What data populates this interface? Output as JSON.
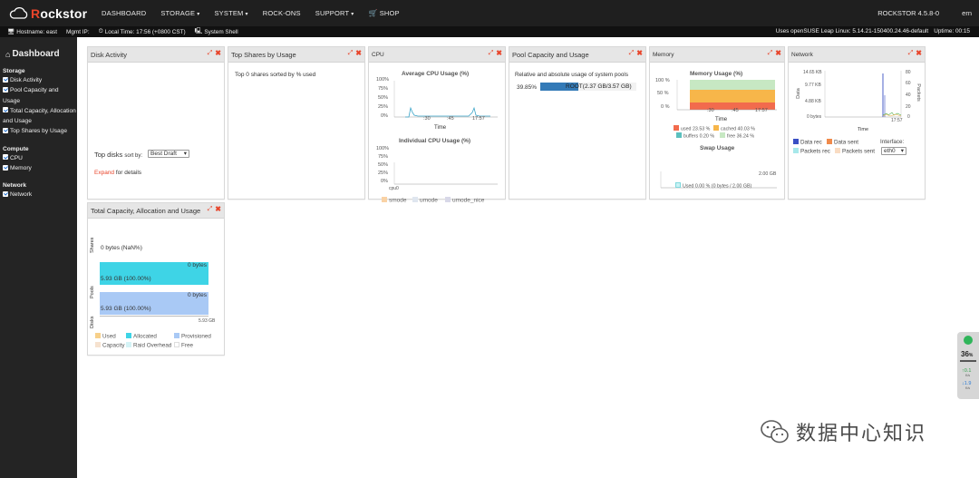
{
  "app": {
    "logo_text_prefix": "R",
    "logo_text_rest": "ockstor",
    "version": "ROCKSTOR 4.5.8-0",
    "user": "ern"
  },
  "nav": {
    "items": [
      {
        "label": "DASHBOARD",
        "caret": ""
      },
      {
        "label": "STORAGE",
        "caret": "▾"
      },
      {
        "label": "SYSTEM",
        "caret": "▾"
      },
      {
        "label": "ROCK-ONS",
        "caret": ""
      },
      {
        "label": "SUPPORT",
        "caret": "▾"
      }
    ],
    "shop_label": "SHOP"
  },
  "status": {
    "hostname": "Hostname: east",
    "mgmt_ip": "Mgmt IP:",
    "local_time": "Local Time: 17:56 (+0800 CST)",
    "system_shell": "System Shell",
    "os_info": "Uses openSUSE Leap  Linux: 5.14.21-150400.24.46-default",
    "uptime": "Uptime: 00:15"
  },
  "sidebar": {
    "title": "Dashboard",
    "sections": [
      {
        "title": "Storage",
        "items": [
          "Disk Activity",
          "Pool Capacity and Usage",
          "Total Capacity, Allocation and Usage",
          "Top Shares by Usage"
        ]
      },
      {
        "title": "Compute",
        "items": [
          "CPU",
          "Memory"
        ]
      },
      {
        "title": "Network",
        "items": [
          "Network"
        ]
      }
    ]
  },
  "widgets": {
    "disk_activity": {
      "title": "Disk Activity",
      "top_disks_label": "Top disks",
      "sort_by_label": "sort by:",
      "sort_value": "Best Draft",
      "expand_link": "Expand",
      "expand_suffix": "for details"
    },
    "top_shares": {
      "title": "Top Shares by Usage",
      "text": "Top 0 shares sorted by % used"
    },
    "cpu": {
      "title": "CPU",
      "chart1_title": "Average CPU Usage (%)",
      "chart2_title": "Individual CPU Usage (%)",
      "y_ticks": [
        "100%",
        "75%",
        "50%",
        "25%",
        "0%"
      ],
      "x_ticks": [
        ":30",
        ":45",
        "17:57"
      ],
      "xlabel": "Time",
      "cpu_label": "cpu0",
      "legend": [
        "smode",
        "umode",
        "umode_nice"
      ]
    },
    "pool": {
      "title": "Pool Capacity and Usage",
      "desc": "Relative and absolute usage of system pools",
      "percent": "39.85%",
      "bar_label": "ROOT(2.37 GB/3.57 GB)",
      "fill_fraction": 0.3985
    },
    "memory": {
      "title": "Memory",
      "chart_title": "Memory Usage (%)",
      "y_ticks": [
        "100 %",
        "50 %",
        "0 %"
      ],
      "x_ticks": [
        ":30",
        ":45",
        "17:57"
      ],
      "xlabel": "Time",
      "legend": [
        "used 23.53 %",
        "cached 40.03 %",
        "buffers 0.20 %",
        "free 36.24 %"
      ],
      "swap_title": "Swap Usage",
      "swap_max": "2.00 GB",
      "swap_legend": "Used 0.00 % (0 bytes / 2.00 GB)"
    },
    "network": {
      "title": "Network",
      "y_left_ticks": [
        "14.65 KB",
        "9.77 KB",
        "4.88 KB",
        "0 bytes"
      ],
      "y_right_ticks": [
        "80",
        "60",
        "40",
        "20",
        "0"
      ],
      "x_tick": "17:57",
      "xlabel": "Time",
      "ylabel_left": "Data",
      "ylabel_right": "Packets",
      "legend": [
        "Data rec",
        "Data sent",
        "Packets rec",
        "Packets sent"
      ],
      "interface_label": "Interface:",
      "interface_value": "eth0"
    },
    "total_capacity": {
      "title": "Total Capacity, Allocation and Usage",
      "rows": [
        {
          "name": "Shares",
          "left": "0 bytes (NaN%)",
          "right": ""
        },
        {
          "name": "Pools",
          "left": "5.93 GB (100.00%)",
          "right": "0 bytes"
        },
        {
          "name": "Disks",
          "left": "5.93 GB (100.00%)",
          "right": "0 bytes"
        }
      ],
      "axis_max": "5.93 GB",
      "legend": [
        "Used",
        "Allocated",
        "Provisioned",
        "Capacity",
        "Raid Overhead",
        "Free"
      ]
    }
  },
  "tray": {
    "value": "36",
    "unit": "%",
    "up": "0.1",
    "down": "1.9",
    "up_unit": "K/s",
    "down_unit": "K/s"
  },
  "watermark": {
    "text": "数据中心知识"
  },
  "colors": {
    "accent": "#e8452b",
    "pool_bar": "#337ab7",
    "cpu_line": "#3aa4c8",
    "mem_used": "#f26b4d",
    "mem_cached": "#f7b64a",
    "mem_free": "#c7e8c3",
    "mem_buffers": "#5bc0be",
    "pools_bar": "#3ed4e6",
    "disks_bar": "#a9c9f5"
  }
}
